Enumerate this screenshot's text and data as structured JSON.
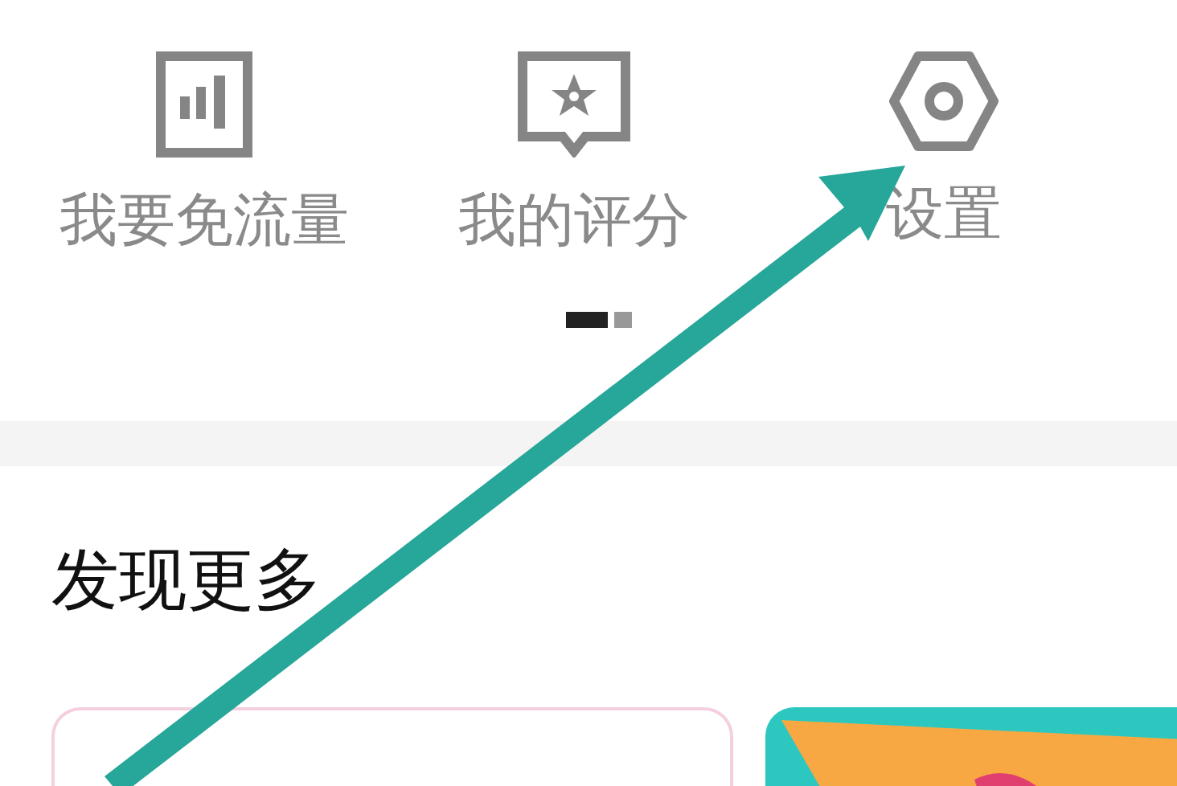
{
  "menu_items": [
    {
      "kind": "chart",
      "label": "我要免流量"
    },
    {
      "kind": "rating",
      "label": "我的评分"
    },
    {
      "kind": "settings",
      "label": "设置"
    }
  ],
  "pager": [
    {
      "selected": true
    },
    {
      "selected": false
    }
  ],
  "section": {
    "title": "发现更多"
  },
  "cards": [
    {
      "kind": "topic"
    },
    {
      "kind": "picture"
    }
  ]
}
